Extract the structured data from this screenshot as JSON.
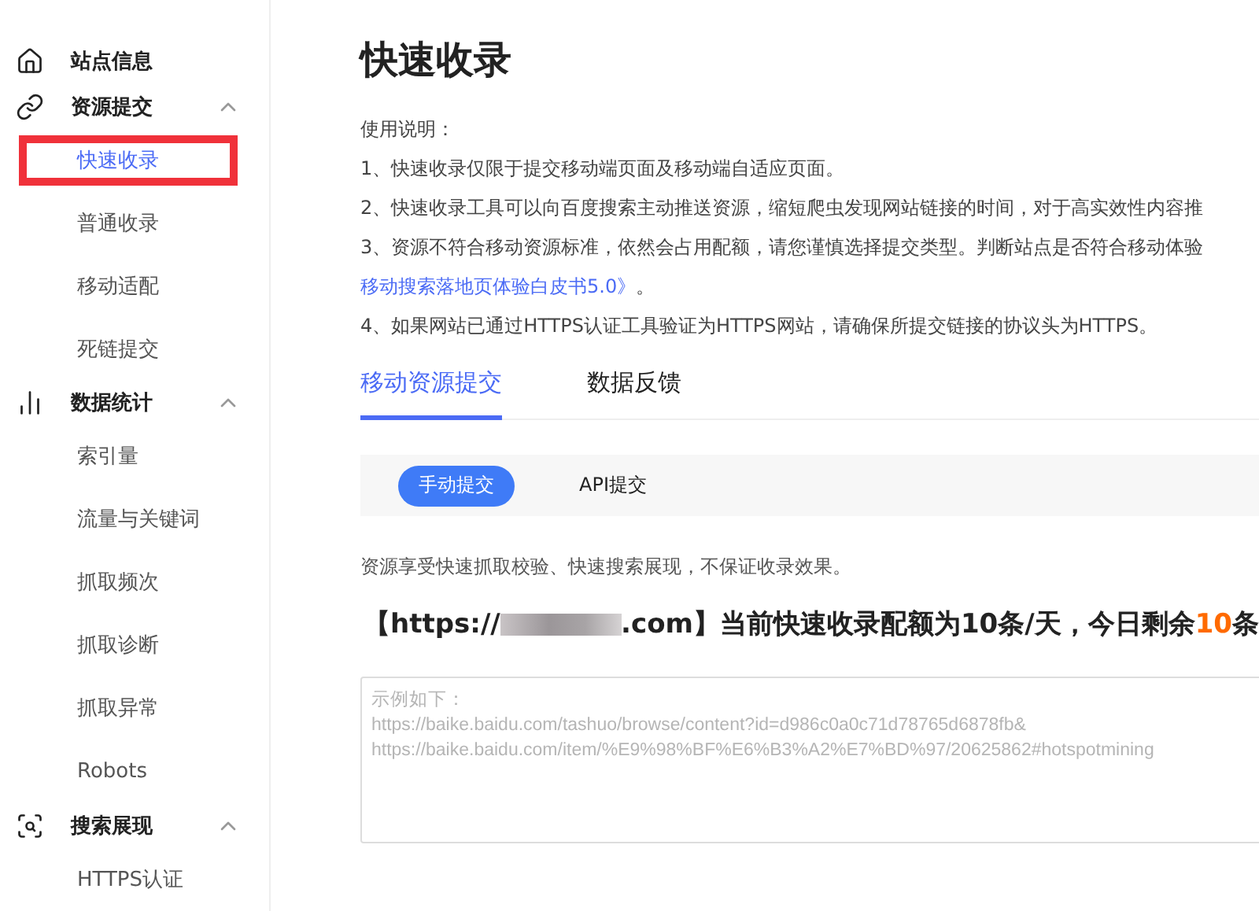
{
  "sidebar": {
    "groups": [
      {
        "label": "站点信息",
        "kind": "home"
      },
      {
        "label": "资源提交",
        "kind": "link",
        "expanded": true,
        "items": [
          {
            "label": "快速收录",
            "selected": true
          },
          {
            "label": "普通收录",
            "selected": false
          },
          {
            "label": "移动适配",
            "selected": false
          },
          {
            "label": "死链提交",
            "selected": false
          }
        ]
      },
      {
        "label": "数据统计",
        "kind": "chart",
        "expanded": true,
        "items": [
          {
            "label": "索引量",
            "selected": false
          },
          {
            "label": "流量与关键词",
            "selected": false
          },
          {
            "label": "抓取频次",
            "selected": false
          },
          {
            "label": "抓取诊断",
            "selected": false
          },
          {
            "label": "抓取异常",
            "selected": false
          },
          {
            "label": "Robots",
            "selected": false
          }
        ]
      },
      {
        "label": "搜索展现",
        "kind": "search",
        "expanded": true,
        "items": [
          {
            "label": "HTTPS认证",
            "selected": false
          }
        ]
      }
    ]
  },
  "title": "快速收录",
  "instructions": {
    "heading": "使用说明：",
    "lines": [
      {
        "kind": "text",
        "text": "1、快速收录仅限于提交移动端页面及移动端自适应页面。"
      },
      {
        "kind": "text",
        "text": "2、快速收录工具可以向百度搜索主动推送资源，缩短爬虫发现网站链接的时间，对于高实效性内容推"
      },
      {
        "kind": "text",
        "text": "3、资源不符合移动资源标准，依然会占用配额，请您谨慎选择提交类型。判断站点是否符合移动体验"
      },
      {
        "kind": "link",
        "link": "移动搜索落地页体验白皮书5.0》",
        "text": "。"
      },
      {
        "kind": "text",
        "text": "4、如果网站已通过HTTPS认证工具验证为HTTPS网站，请确保所提交链接的协议头为HTTPS。"
      }
    ]
  },
  "tabs": [
    {
      "label": "移动资源提交",
      "selected": true
    },
    {
      "label": "数据反馈",
      "selected": false
    }
  ],
  "sub_tabs": [
    {
      "label": "手动提交",
      "selected": true
    },
    {
      "label": "API提交",
      "selected": false
    }
  ],
  "note": "资源享受快速抓取校验、快速搜索展现，不保证收录效果。",
  "quota": {
    "prefix": "【https://",
    "suffix": ".com】当前快速收录配额为10条/天，今日剩余",
    "remaining": "10",
    "unit": "条"
  },
  "url_input": {
    "placeholder": "示例如下：\nhttps://baike.baidu.com/tashuo/browse/content?id=d986c0a0c71d78765d6878fb&\nhttps://baike.baidu.com/item/%E9%98%BF%E6%B3%A2%E7%BD%97/20625862#hotspotmining"
  }
}
